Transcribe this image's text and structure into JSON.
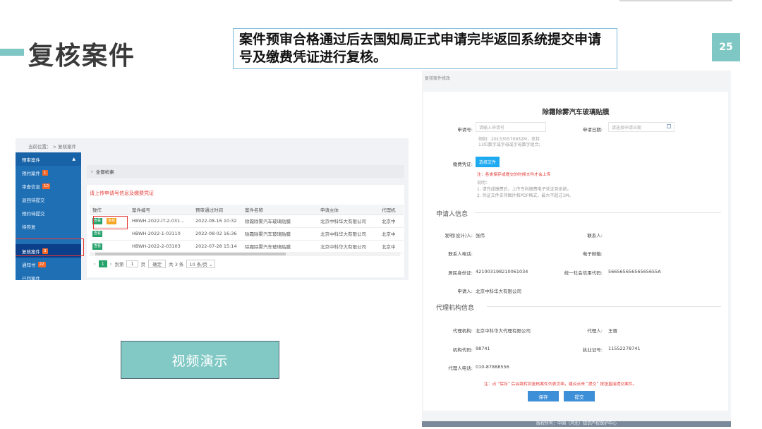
{
  "slide": {
    "title": "复核案件",
    "description": "案件预审合格通过后去国知局正式申请完毕返回系统提交申请号及缴费凭证进行复核。",
    "page_number": "25",
    "video_label": "视频演示",
    "accent_color": "#7fc7c4"
  },
  "left_screen": {
    "breadcrumb": "当前位置：  >  复核案件",
    "sidebar": {
      "head": "预审案件",
      "items": [
        {
          "label": "预约案件",
          "badge": "1"
        },
        {
          "label": "审查信息",
          "badge": "10"
        },
        {
          "label": "退回待提交",
          "badge": ""
        },
        {
          "label": "预约待提交",
          "badge": ""
        },
        {
          "label": "待答复",
          "badge": ""
        },
        {
          "label": "复核案件",
          "badge": "3",
          "active": true
        },
        {
          "label": "通知书",
          "badge": "22"
        },
        {
          "label": "已回案件",
          "badge": ""
        }
      ]
    },
    "filter_label": "全部检索",
    "panel_title": "请上传申请号信息及缴费凭证",
    "table": {
      "headers": [
        "操作",
        "案件编号",
        "预审通过时间",
        "案件名称",
        "申请主体",
        "代理机"
      ],
      "view_label": "查看",
      "review_label": "复核",
      "rows": [
        {
          "id": "HBWH-2022-IT-2-031...",
          "time": "2022-08-16 10:32",
          "name": "除霜除雾汽车玻璃贴膜",
          "applicant": "北京中科华大有限公司",
          "agency": "北京中"
        },
        {
          "id": "HBWH-2022-1-03110",
          "time": "2022-08-02 16:36",
          "name": "除霜除雾汽车玻璃贴膜",
          "applicant": "北京中科华大有限公司",
          "agency": "北京中"
        },
        {
          "id": "HBWH-2022-2-03103",
          "time": "2022-07-28 15:14",
          "name": "除霜除雾汽车玻璃贴膜",
          "applicant": "北京中科华大有限公司",
          "agency": "北京中"
        }
      ]
    },
    "pager": {
      "current": "1",
      "goto_label": "到第",
      "page_input": "1",
      "page_unit": "页",
      "confirm": "确定",
      "total": "共 3 条",
      "page_size": "10 条/页"
    }
  },
  "right_screen": {
    "breadcrumb": "复核案件修改",
    "form_title": "除霜除雾汽车玻璃贴膜",
    "application_no_label": "申请号:",
    "application_no_placeholder": "请输入申请号",
    "application_date_label": "申请日期:",
    "application_date_placeholder": "请选择申请日期",
    "application_no_hint_1": "例如：201530570932M，支持",
    "application_no_hint_2": "13位数字或字母或字母数字组合;",
    "payment_label": "缴费凭证:",
    "choose_file": "选择文件",
    "payment_note": "注：各类保存或提交的时候文件才会上传",
    "payment_hint_1": "说明：",
    "payment_hint_2": "1. 请完成缴费后，上传专利缴费电子凭证到系统。",
    "payment_hint_3": "2. 凭证文件支持图片和PDF格式，最大不超过1M。",
    "applicant_section": "申请人信息",
    "inventor_label": "发明(设计)人:",
    "inventor_value": "张伟",
    "contact_label": "联系人:",
    "contact_value": "",
    "contact_phone_label": "联系人电话:",
    "contact_phone_value": "",
    "email_label": "电子邮箱:",
    "email_value": "",
    "id_label": "居民身份证:",
    "id_value": "421003198210061034",
    "credit_label": "统一社会信用代码:",
    "credit_value": "56656565656565655A",
    "applicant_label": "申请人:",
    "applicant_value": "北京中科华大有限公司",
    "agency_section": "代理机构信息",
    "agency_label": "代理机构:",
    "agency_value": "北京中科华大代理有限公司",
    "agent_label": "代理人:",
    "agent_value": "王晋",
    "agency_code_label": "机构代码:",
    "agency_code_value": "98741",
    "license_label": "执业证号:",
    "license_value": "11552278741",
    "agent_phone_label": "代理人电话:",
    "agent_phone_value": "010-87888556",
    "bottom_note": "注：点 “保存” 后会跳转到复核案件列表页面，建议点击 “提交” 按钮直接提交案件。",
    "save_label": "保存",
    "submit_label": "提交",
    "footer": "版权所有：中国（河北）知识产权保护中心"
  }
}
